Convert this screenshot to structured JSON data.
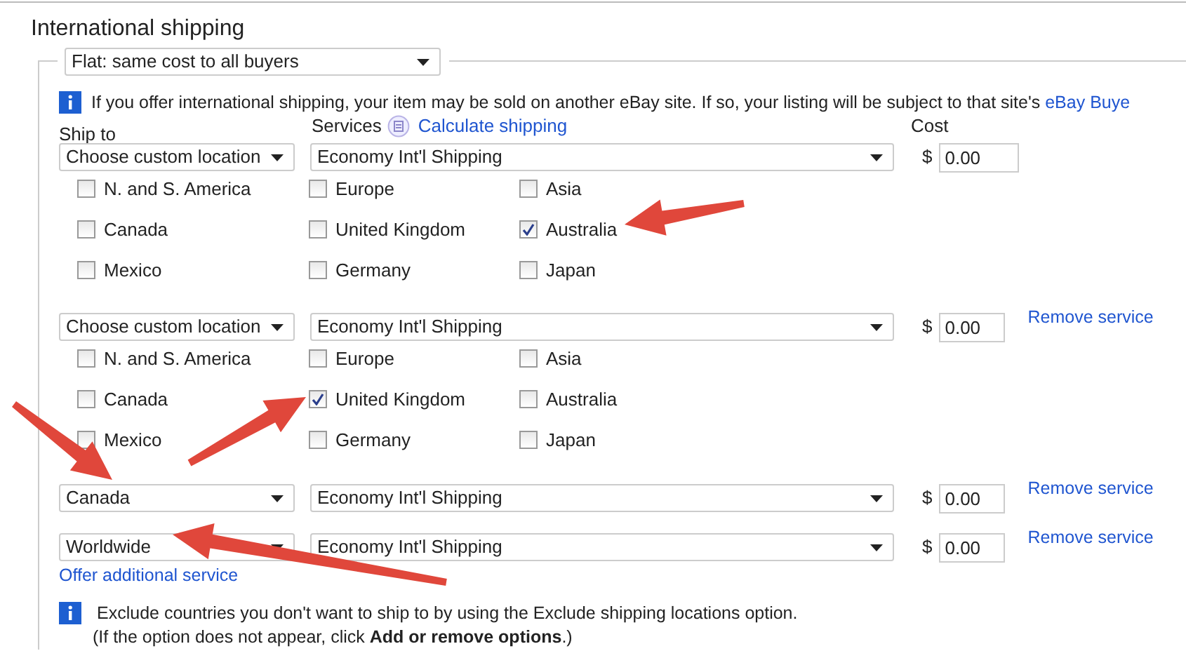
{
  "section_title": "International shipping",
  "shipping_type": {
    "value": "Flat: same cost to all buyers"
  },
  "notice": {
    "text": "If you offer international shipping, your item may be sold on another eBay site. If so, your listing will be subject to that site's ",
    "link": "eBay Buye"
  },
  "labels": {
    "ship_to": "Ship to",
    "services": "Services",
    "calculate_link": "Calculate shipping",
    "cost": "Cost"
  },
  "services": [
    {
      "ship_to": "Choose custom location",
      "service": "Economy Int'l Shipping",
      "currency": "$",
      "cost": "0.00",
      "regions": [
        {
          "label": "N. and S. America",
          "checked": false
        },
        {
          "label": "Europe",
          "checked": false
        },
        {
          "label": "Asia",
          "checked": false
        },
        {
          "label": "Canada",
          "checked": false
        },
        {
          "label": "United Kingdom",
          "checked": false
        },
        {
          "label": "Australia",
          "checked": true
        },
        {
          "label": "Mexico",
          "checked": false
        },
        {
          "label": "Germany",
          "checked": false
        },
        {
          "label": "Japan",
          "checked": false
        }
      ]
    },
    {
      "ship_to": "Choose custom location",
      "service": "Economy Int'l Shipping",
      "currency": "$",
      "cost": "0.00",
      "remove_link": "Remove service",
      "regions": [
        {
          "label": "N. and S. America",
          "checked": false
        },
        {
          "label": "Europe",
          "checked": false
        },
        {
          "label": "Asia",
          "checked": false
        },
        {
          "label": "Canada",
          "checked": false
        },
        {
          "label": "United Kingdom",
          "checked": true
        },
        {
          "label": "Australia",
          "checked": false
        },
        {
          "label": "Mexico",
          "checked": false
        },
        {
          "label": "Germany",
          "checked": false
        },
        {
          "label": "Japan",
          "checked": false
        }
      ]
    },
    {
      "ship_to": "Canada",
      "service": "Economy Int'l Shipping",
      "currency": "$",
      "cost": "0.00",
      "remove_link": "Remove service"
    },
    {
      "ship_to": "Worldwide",
      "service": "Economy Int'l Shipping",
      "currency": "$",
      "cost": "0.00",
      "remove_link": "Remove service"
    }
  ],
  "offer_link": "Offer additional service",
  "exclude_notice": {
    "line1": "Exclude countries you don't want to ship to by using the Exclude shipping locations option.",
    "line2": "(If the option does not appear, click **Add or remove options**.)"
  }
}
